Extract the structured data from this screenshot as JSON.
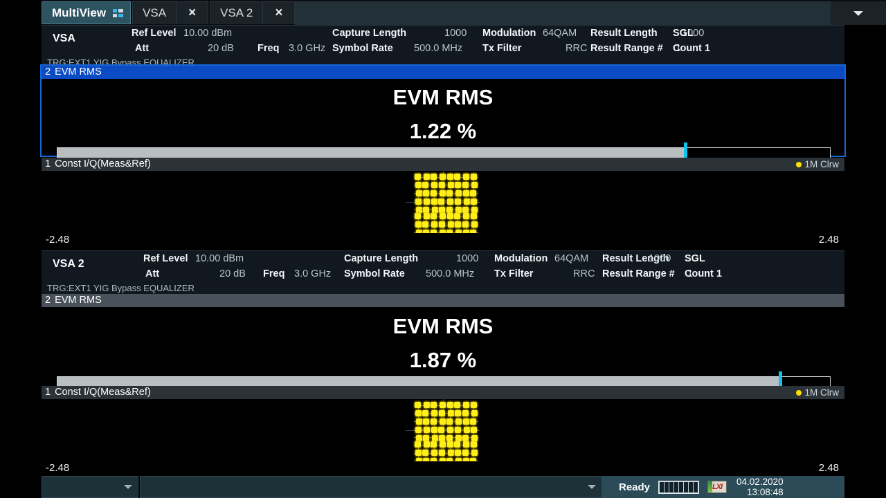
{
  "tabbar": {
    "multiview": "MultiView",
    "multiview_icon": "multiview-grid-icon",
    "tabs": [
      {
        "label": "VSA",
        "close": "×"
      },
      {
        "label": "VSA 2",
        "close": "×"
      }
    ],
    "overflow_icon": "chevron-down-icon"
  },
  "channels": [
    {
      "id": "vsa1",
      "name": "VSA",
      "fields": [
        {
          "label": "Ref Level",
          "value": "10.00 dBm"
        },
        {
          "label": "Att",
          "value": "20 dB"
        },
        {
          "label": "Freq",
          "value": "3.0 GHz"
        },
        {
          "label": "Capture Length",
          "value": "1000"
        },
        {
          "label": "Symbol Rate",
          "value": "500.0 MHz"
        },
        {
          "label": "Modulation",
          "value": "64QAM"
        },
        {
          "label": "Tx Filter",
          "value": "RRC"
        },
        {
          "label": "Result Length",
          "value": "1000"
        },
        {
          "label": "Result Range #",
          "value": "1"
        },
        {
          "label": "SGL",
          "value": ""
        },
        {
          "label": "Count 1",
          "value": ""
        }
      ],
      "trigger_line": "TRG:EXT1 YIG Bypass EQUALIZER",
      "evm_window": {
        "number": "2",
        "title": "EVM RMS",
        "heading": "EVM RMS",
        "value": "1.22 %",
        "bar_percent": 81.2,
        "marker_percent": 81.2,
        "selected": true
      },
      "const_window": {
        "number": "1",
        "title": "Const I/Q(Meas&Ref)",
        "trace": "1M Clrw",
        "trace_dot_color": "#ffe000",
        "axis_left": "-2.48",
        "axis_right": "2.48",
        "modulation_points": 64
      }
    },
    {
      "id": "vsa2",
      "name": "VSA 2",
      "fields": [
        {
          "label": "Ref Level",
          "value": "10.00 dBm"
        },
        {
          "label": "Att",
          "value": "20 dB"
        },
        {
          "label": "Freq",
          "value": "3.0 GHz"
        },
        {
          "label": "Capture Length",
          "value": "1000"
        },
        {
          "label": "Symbol Rate",
          "value": "500.0 MHz"
        },
        {
          "label": "Modulation",
          "value": "64QAM"
        },
        {
          "label": "Tx Filter",
          "value": "RRC"
        },
        {
          "label": "Result Length",
          "value": "1000"
        },
        {
          "label": "Result Range #",
          "value": "1"
        },
        {
          "label": "SGL",
          "value": ""
        },
        {
          "label": "Count 1",
          "value": ""
        }
      ],
      "trigger_line": "TRG:EXT1 YIG Bypass EQUALIZER",
      "evm_window": {
        "number": "2",
        "title": "EVM RMS",
        "heading": "EVM RMS",
        "value": "1.87 %",
        "bar_percent": 93.5,
        "marker_percent": 93.5,
        "selected": false
      },
      "const_window": {
        "number": "1",
        "title": "Const I/Q(Meas&Ref)",
        "trace": "1M Clrw",
        "trace_dot_color": "#ffe000",
        "axis_left": "-2.48",
        "axis_right": "2.48",
        "modulation_points": 64
      }
    }
  ],
  "statusbar": {
    "combo_value": "",
    "field_value": "",
    "status": "Ready",
    "lxi_label": "LXI",
    "date": "04.02.2020",
    "time": "13:08:48",
    "segments": 8
  },
  "colors": {
    "accent_selected": "#0b4bc4",
    "marker": "#0fc3ea",
    "trace": "#ffef18",
    "bar_fill": "#b9bec1",
    "panel_bg": "#121820"
  }
}
